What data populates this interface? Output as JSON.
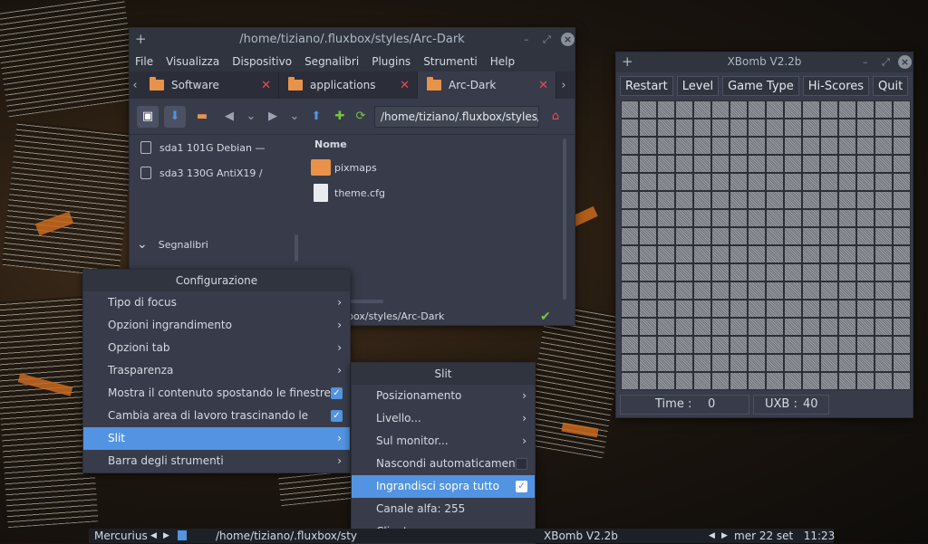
{
  "filemanager": {
    "title": "/home/tiziano/.fluxbox/styles/Arc-Dark",
    "menus": [
      "File",
      "Visualizza",
      "Dispositivo",
      "Segnalibri",
      "Plugins",
      "Strumenti",
      "Help"
    ],
    "tabs": [
      {
        "label": "Software"
      },
      {
        "label": "applications"
      },
      {
        "label": "Arc-Dark"
      }
    ],
    "path": "/home/tiziano/.fluxbox/styles/Arc-D",
    "devices": [
      {
        "label": "sda1 101G Debian —"
      },
      {
        "label": "sda3 130G AntiX19 /"
      }
    ],
    "bookmarks_label": "Segnalibri",
    "column_header": "Nome",
    "files": [
      {
        "name": "pixmaps",
        "type": "folder"
      },
      {
        "name": "theme.cfg",
        "type": "file"
      }
    ],
    "status_path": "box/styles/Arc-Dark"
  },
  "config_menu": {
    "title": "Configurazione",
    "items": [
      {
        "label": "Tipo di focus",
        "kind": "submenu"
      },
      {
        "label": "Opzioni ingrandimento",
        "kind": "submenu"
      },
      {
        "label": "Opzioni tab",
        "kind": "submenu"
      },
      {
        "label": "Trasparenza",
        "kind": "submenu"
      },
      {
        "label": "Mostra il contenuto spostando le finestre",
        "kind": "check",
        "checked": true
      },
      {
        "label": "Cambia area di lavoro trascinando le finestre",
        "kind": "check",
        "checked": true
      },
      {
        "label": "Slit",
        "kind": "submenu",
        "selected": true
      },
      {
        "label": "Barra degli strumenti",
        "kind": "submenu"
      }
    ]
  },
  "slit_menu": {
    "title": "Slit",
    "items": [
      {
        "label": "Posizionamento",
        "kind": "submenu"
      },
      {
        "label": "Livello...",
        "kind": "submenu"
      },
      {
        "label": "Sul monitor...",
        "kind": "submenu"
      },
      {
        "label": "Nascondi automaticamente",
        "kind": "check",
        "checked": false
      },
      {
        "label": "Ingrandisci sopra tutto",
        "kind": "check",
        "checked": true,
        "selected": true
      },
      {
        "label": "Canale alfa:  255",
        "kind": "plain"
      },
      {
        "label": "Client",
        "kind": "submenu"
      }
    ]
  },
  "xbomb": {
    "title": "XBomb V2.2b",
    "buttons": [
      "Restart",
      "Level",
      "Game Type",
      "Hi-Scores",
      "Quit"
    ],
    "time_label": "Time :",
    "time_value": "0",
    "uxb_label": "UXB :",
    "uxb_value": "40",
    "grid_size": 16
  },
  "taskbar": {
    "workspace": "Mercurius",
    "active_window": "/home/tiziano/.fluxbox/sty",
    "window2": "XBomb V2.2b",
    "clock": "mer 22 set   11:23"
  },
  "colors": {
    "accent": "#5294e2",
    "folder": "#e8924a",
    "close": "#f04a50"
  }
}
